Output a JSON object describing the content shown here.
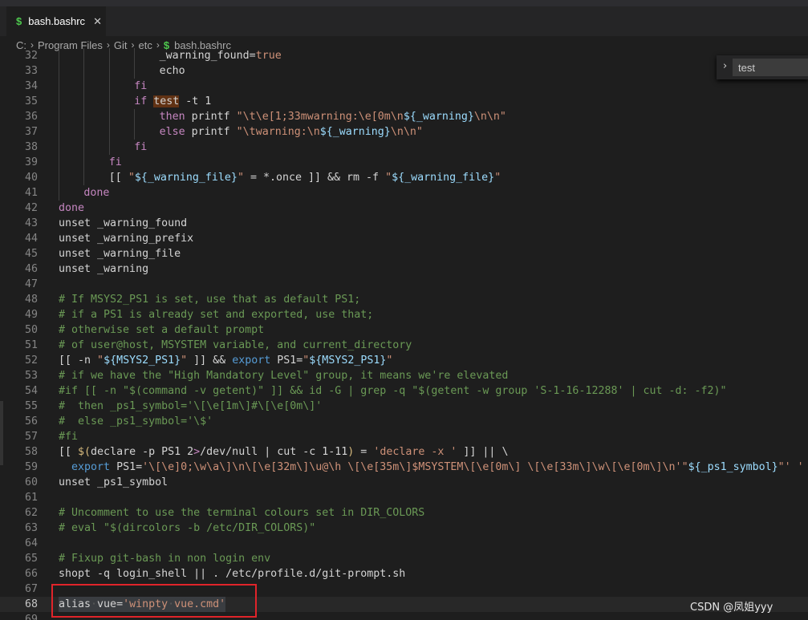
{
  "tab": {
    "icon": "$",
    "label": "bash.bashrc",
    "close": "✕"
  },
  "breadcrumb": [
    "C:",
    "Program Files",
    "Git",
    "etc",
    "bash.bashrc"
  ],
  "find": {
    "value": "test"
  },
  "watermark": "CSDN @凤姐yyy",
  "lines": [
    {
      "n": "32",
      "indent": 4,
      "tokens": [
        [
          "_warning_found=",
          "p"
        ],
        [
          "true",
          "str"
        ]
      ]
    },
    {
      "n": "33",
      "indent": 4,
      "tokens": [
        [
          "echo",
          "p"
        ]
      ]
    },
    {
      "n": "34",
      "indent": 3,
      "tokens": [
        [
          "fi",
          "kw"
        ]
      ]
    },
    {
      "n": "35",
      "indent": 3,
      "tokens": [
        [
          "if ",
          "kw"
        ],
        [
          "test",
          "hl"
        ],
        [
          " -t 1",
          "p"
        ]
      ]
    },
    {
      "n": "36",
      "indent": 4,
      "tokens": [
        [
          "then ",
          "kw"
        ],
        [
          "printf ",
          "p"
        ],
        [
          "\"\\t\\e[1;33mwarning:\\e[0m\\n",
          "str"
        ],
        [
          "${_warning}",
          "var"
        ],
        [
          "\\n\\n\"",
          "str"
        ]
      ]
    },
    {
      "n": "37",
      "indent": 4,
      "tokens": [
        [
          "else ",
          "kw"
        ],
        [
          "printf ",
          "p"
        ],
        [
          "\"\\twarning:\\n",
          "str"
        ],
        [
          "${_warning}",
          "var"
        ],
        [
          "\\n\\n\"",
          "str"
        ]
      ]
    },
    {
      "n": "38",
      "indent": 3,
      "tokens": [
        [
          "fi",
          "kw"
        ]
      ]
    },
    {
      "n": "39",
      "indent": 2,
      "tokens": [
        [
          "fi",
          "kw"
        ]
      ]
    },
    {
      "n": "40",
      "indent": 2,
      "tokens": [
        [
          "[[ ",
          "p"
        ],
        [
          "\"",
          "str"
        ],
        [
          "${_warning_file}",
          "var"
        ],
        [
          "\"",
          "str"
        ],
        [
          " = *.once ]] && rm -f ",
          "p"
        ],
        [
          "\"",
          "str"
        ],
        [
          "${_warning_file}",
          "var"
        ],
        [
          "\"",
          "str"
        ]
      ]
    },
    {
      "n": "41",
      "indent": 1,
      "tokens": [
        [
          "done",
          "kw"
        ]
      ]
    },
    {
      "n": "42",
      "indent": 0,
      "tokens": [
        [
          "done",
          "kw"
        ]
      ]
    },
    {
      "n": "43",
      "indent": 0,
      "tokens": [
        [
          "unset _warning_found",
          "p"
        ]
      ]
    },
    {
      "n": "44",
      "indent": 0,
      "tokens": [
        [
          "unset _warning_prefix",
          "p"
        ]
      ]
    },
    {
      "n": "45",
      "indent": 0,
      "tokens": [
        [
          "unset _warning_file",
          "p"
        ]
      ]
    },
    {
      "n": "46",
      "indent": 0,
      "tokens": [
        [
          "unset _warning",
          "p"
        ]
      ]
    },
    {
      "n": "47",
      "indent": 0,
      "tokens": []
    },
    {
      "n": "48",
      "indent": 0,
      "tokens": [
        [
          "# If MSYS2_PS1 is set, use that as default PS1;",
          "cmt"
        ]
      ]
    },
    {
      "n": "49",
      "indent": 0,
      "tokens": [
        [
          "# if a PS1 is already set and exported, use that;",
          "cmt"
        ]
      ]
    },
    {
      "n": "50",
      "indent": 0,
      "tokens": [
        [
          "# otherwise set a default prompt",
          "cmt"
        ]
      ]
    },
    {
      "n": "51",
      "indent": 0,
      "tokens": [
        [
          "# of user@host, MSYSTEM variable, and current_directory",
          "cmt"
        ]
      ]
    },
    {
      "n": "52",
      "indent": 0,
      "tokens": [
        [
          "[[ -n ",
          "p"
        ],
        [
          "\"",
          "str"
        ],
        [
          "${MSYS2_PS1}",
          "var"
        ],
        [
          "\"",
          "str"
        ],
        [
          " ]] && ",
          "p"
        ],
        [
          "export",
          "bi"
        ],
        [
          " PS1=",
          "p"
        ],
        [
          "\"",
          "str"
        ],
        [
          "${MSYS2_PS1}",
          "var"
        ],
        [
          "\"",
          "str"
        ]
      ]
    },
    {
      "n": "53",
      "indent": 0,
      "tokens": [
        [
          "# if we have the \"High Mandatory Level\" group, it means we're elevated",
          "cmt"
        ]
      ]
    },
    {
      "n": "54",
      "indent": 0,
      "tokens": [
        [
          "#if [[ -n \"$(command -v getent)\" ]] && id -G | grep -q \"$(getent -w group 'S-1-16-12288' | cut -d: -f2)\"",
          "cmt"
        ]
      ]
    },
    {
      "n": "55",
      "indent": 0,
      "tokens": [
        [
          "#  then _ps1_symbol='\\[\\e[1m\\]#\\[\\e[0m\\]'",
          "cmt"
        ]
      ]
    },
    {
      "n": "56",
      "indent": 0,
      "tokens": [
        [
          "#  else _ps1_symbol='\\$'",
          "cmt"
        ]
      ]
    },
    {
      "n": "57",
      "indent": 0,
      "tokens": [
        [
          "#fi",
          "cmt"
        ]
      ]
    },
    {
      "n": "58",
      "indent": 0,
      "tokens": [
        [
          "[[ ",
          "p"
        ],
        [
          "$(",
          "esc"
        ],
        [
          "declare -p PS1 2",
          "p"
        ],
        [
          ">",
          "kw"
        ],
        [
          "/dev/null | cut -c 1-11",
          "p"
        ],
        [
          ")",
          "esc"
        ],
        [
          " = ",
          "p"
        ],
        [
          "'declare -x '",
          "str"
        ],
        [
          " ]] || \\",
          "p"
        ]
      ]
    },
    {
      "n": "59",
      "indent": 0,
      "tokens": [
        [
          "  ",
          "p"
        ],
        [
          "export",
          "bi"
        ],
        [
          " PS1=",
          "p"
        ],
        [
          "'\\[\\e]0;\\w\\a\\]\\n\\[\\e[32m\\]\\u@\\h \\[\\e[35m\\]$MSYSTEM\\[\\e[0m\\] \\[\\e[33m\\]\\w\\[\\e[0m\\]\\n'",
          "str"
        ],
        [
          "\"",
          "str"
        ],
        [
          "${_ps1_symbol}",
          "var"
        ],
        [
          "\"",
          "str"
        ],
        [
          "' '",
          "str"
        ]
      ]
    },
    {
      "n": "60",
      "indent": 0,
      "tokens": [
        [
          "unset _ps1_symbol",
          "p"
        ]
      ]
    },
    {
      "n": "61",
      "indent": 0,
      "tokens": []
    },
    {
      "n": "62",
      "indent": 0,
      "tokens": [
        [
          "# Uncomment to use the terminal colours set in DIR_COLORS",
          "cmt"
        ]
      ]
    },
    {
      "n": "63",
      "indent": 0,
      "tokens": [
        [
          "# eval \"$(dircolors -b /etc/DIR_COLORS)\"",
          "cmt"
        ]
      ]
    },
    {
      "n": "64",
      "indent": 0,
      "tokens": []
    },
    {
      "n": "65",
      "indent": 0,
      "tokens": [
        [
          "# Fixup git-bash in non login env",
          "cmt"
        ]
      ]
    },
    {
      "n": "66",
      "indent": 0,
      "tokens": [
        [
          "shopt -q login_shell || . /etc/profile.d/git-prompt.sh",
          "p"
        ]
      ]
    },
    {
      "n": "67",
      "indent": 0,
      "tokens": []
    },
    {
      "n": "68",
      "indent": 0,
      "cur": true,
      "tokens": [
        [
          "alias",
          "p"
        ],
        [
          "·",
          "ws"
        ],
        [
          "vue=",
          "p"
        ],
        [
          "'winpty",
          "str"
        ],
        [
          "·",
          "ws"
        ],
        [
          "vue.cmd'",
          "str"
        ]
      ]
    },
    {
      "n": "69",
      "indent": 0,
      "tokens": []
    }
  ]
}
